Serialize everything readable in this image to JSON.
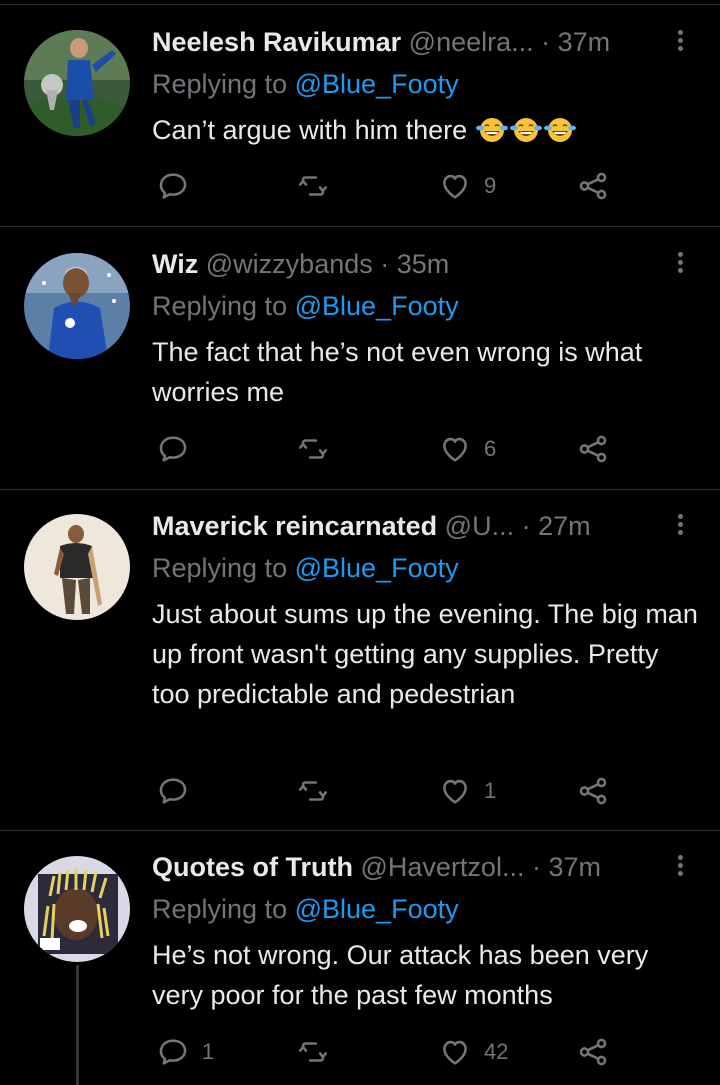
{
  "tweets": [
    {
      "name": "Neelesh Ravikumar",
      "handle": "@neelra...",
      "time": "37m",
      "replying_label": "Replying to",
      "mention": "@Blue_Footy",
      "text": "Can’t argue with him there",
      "emoji_count": 3,
      "reply_count": "",
      "retweet_count": "",
      "like_count": "9"
    },
    {
      "name": "Wiz",
      "handle": "@wizzybands",
      "time": "35m",
      "replying_label": "Replying to",
      "mention": "@Blue_Footy",
      "text": "The fact that he’s not even wrong is what worries me",
      "reply_count": "",
      "retweet_count": "",
      "like_count": "6"
    },
    {
      "name": "Maverick reincarnated",
      "handle": "@U...",
      "time": "27m",
      "replying_label": "Replying to",
      "mention": "@Blue_Footy",
      "text": "Just about sums up the evening. The big man up front wasn't getting any supplies. Pretty too predictable and pedestrian",
      "reply_count": "",
      "retweet_count": "",
      "like_count": "1"
    },
    {
      "name": "Quotes of Truth",
      "handle": "@Havertzol...",
      "time": "37m",
      "replying_label": "Replying to",
      "mention": "@Blue_Footy",
      "text": "He’s not wrong. Our attack has been very very poor for the past few months",
      "reply_count": "1",
      "retweet_count": "",
      "like_count": "42"
    }
  ],
  "icons": {
    "reply": "reply-icon",
    "retweet": "retweet-icon",
    "like": "heart-icon",
    "share": "share-icon",
    "more": "more-options-icon"
  },
  "colors": {
    "background": "#000000",
    "text": "#e7e9ea",
    "secondary": "#71767b",
    "mention": "#1d9bf0",
    "divider": "#2f3336"
  }
}
